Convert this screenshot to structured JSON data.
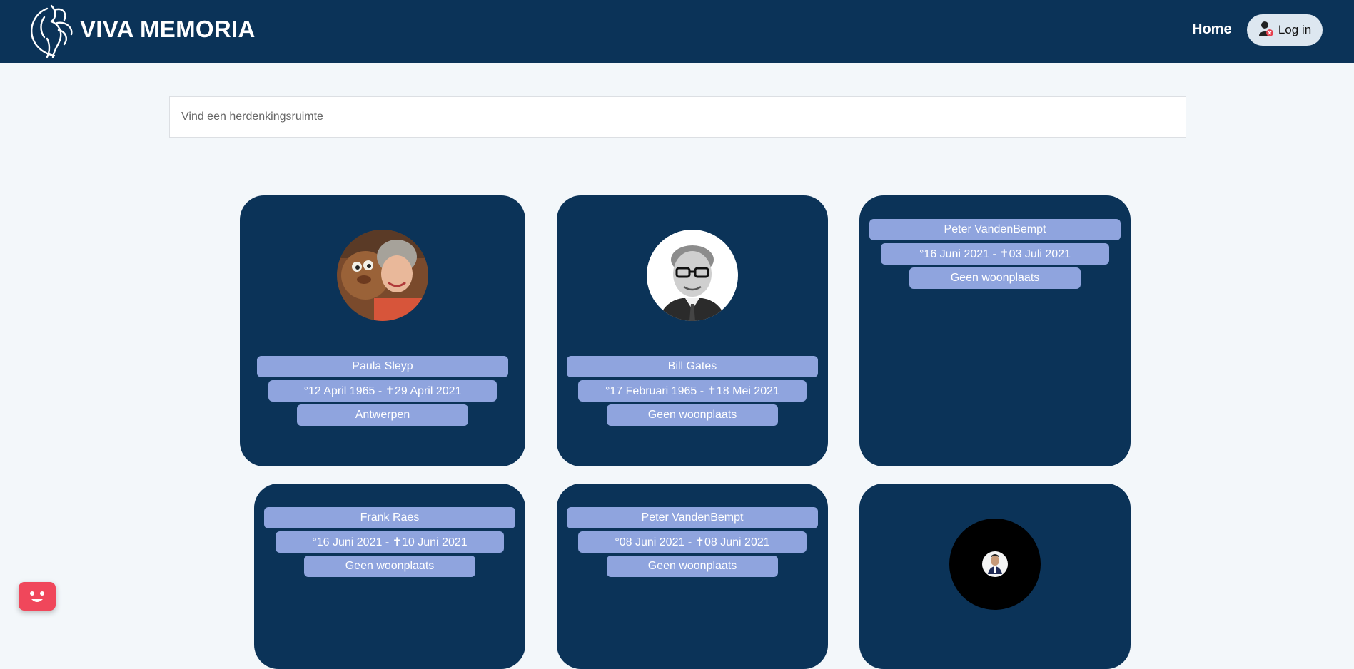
{
  "header": {
    "brand": "VIVA MEMORIA",
    "nav_home": "Home",
    "login_label": "Log in"
  },
  "search": {
    "placeholder": "Vind een herdenkingsruimte"
  },
  "memorials": [
    {
      "name": "Paula Sleyp",
      "dates": "°12 April 1965 - ✝29 April 2021",
      "place": "Antwerpen"
    },
    {
      "name": "Bill Gates",
      "dates": "°17 Februari 1965 - ✝18 Mei 2021",
      "place": "Geen woonplaats"
    },
    {
      "name": "Peter VandenBempt",
      "dates": "°16 Juni 2021 - ✝03 Juli 2021",
      "place": "Geen woonplaats"
    },
    {
      "name": "Frank Raes",
      "dates": "°16 Juni 2021 - ✝10 Juni 2021",
      "place": "Geen woonplaats"
    },
    {
      "name": "Peter VandenBempt",
      "dates": "°08 Juni 2021 - ✝08 Juni 2021",
      "place": "Geen woonplaats"
    },
    {
      "name": "",
      "dates": "",
      "place": ""
    }
  ],
  "colors": {
    "navbar": "#0b3358",
    "card": "#0b3358",
    "pill": "#8fa4de",
    "page_bg": "#f3f7fa",
    "chat_button": "#f0475b"
  },
  "icons": {
    "logo": "phoenix-logo-icon",
    "login": "user-icon",
    "chat": "chat-face-icon"
  }
}
